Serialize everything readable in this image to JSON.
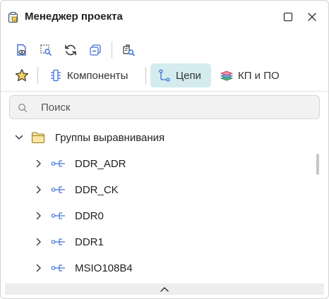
{
  "window": {
    "title": "Менеджер проекта"
  },
  "toolbar": {
    "icons": [
      "document-view-icon",
      "select-frame-icon",
      "refresh-icon",
      "collapse-all-icon",
      "find-icon"
    ]
  },
  "tabs": [
    {
      "label": "Компоненты",
      "icon": "component-icon",
      "active": false
    },
    {
      "label": "Цепи",
      "icon": "net-icon",
      "active": true
    },
    {
      "label": "КП и ПО",
      "icon": "layers-icon",
      "active": false
    }
  ],
  "search": {
    "placeholder": "Поиск",
    "value": ""
  },
  "tree": {
    "group": {
      "label": "Группы выравнивания",
      "expanded": true
    },
    "items": [
      {
        "label": "DDR_ADR"
      },
      {
        "label": "DDR_CK"
      },
      {
        "label": "DDR0"
      },
      {
        "label": "DDR1"
      },
      {
        "label": "MSIO108B4"
      }
    ]
  },
  "colors": {
    "accent": "#3a6fd8",
    "active_tab_bg": "#d4ecee",
    "folder": "#e2b64a"
  }
}
